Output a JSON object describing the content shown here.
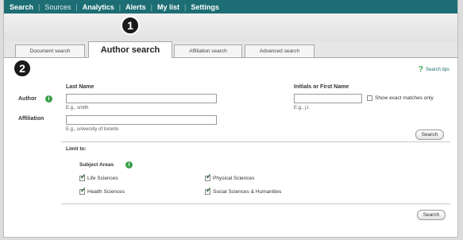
{
  "nav": {
    "items": [
      {
        "label": "Search",
        "active": true
      },
      {
        "label": "Sources",
        "active": false
      },
      {
        "label": "Analytics",
        "active": false
      },
      {
        "label": "Alerts",
        "active": false
      },
      {
        "label": "My list",
        "active": false
      },
      {
        "label": "Settings",
        "active": false
      }
    ]
  },
  "badges": {
    "one": "1",
    "two": "2"
  },
  "tabs": [
    {
      "label": "Document search"
    },
    {
      "label": "Author search"
    },
    {
      "label": "Affiliation search"
    },
    {
      "label": "Advanced search"
    }
  ],
  "help": {
    "label": "Search tips",
    "icon": "question-icon"
  },
  "form": {
    "author_label": "Author",
    "affiliation_label": "Affiliation",
    "last_name_label": "Last Name",
    "last_name_value": "",
    "last_name_hint": "E.g., smith",
    "initials_label": "Initials or First Name",
    "initials_value": "",
    "initials_hint": "E.g., j.l.",
    "exact_match_label": "Show exact matches only",
    "affiliation_value": "",
    "affiliation_hint": "E.g., university of toronto",
    "search_button": "Search",
    "limit_label": "Limit to:",
    "subject_areas_label": "Subject Areas",
    "subjects": [
      {
        "label": "Life Sciences",
        "checked": true
      },
      {
        "label": "Physical Sciences",
        "checked": true
      },
      {
        "label": "Health Sciences",
        "checked": true
      },
      {
        "label": "Social Sciences & Humanities",
        "checked": true
      }
    ],
    "search_button_bottom": "Search"
  },
  "colors": {
    "nav_bg": "#1d6e74",
    "info_green": "#3aa04a",
    "badge_bg": "#1a1a1a"
  }
}
